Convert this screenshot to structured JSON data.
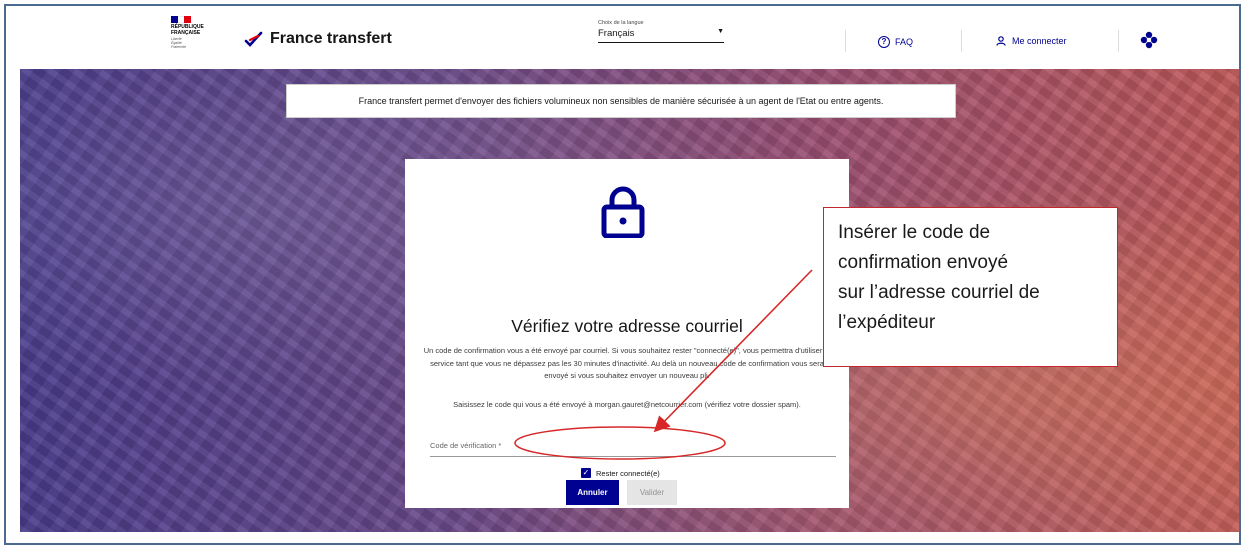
{
  "header": {
    "gov_logo_lines": [
      "RÉPUBLIQUE",
      "FRANÇAISE"
    ],
    "gov_motto": [
      "Liberté",
      "Égalité",
      "Fraternité"
    ],
    "brand_title": "France transfert",
    "language_label": "Choix de la langue",
    "language_value": "Français",
    "faq_label": "FAQ",
    "login_label": "Me connecter",
    "flag_colors": [
      "#000091",
      "#ffffff",
      "#e1000f"
    ]
  },
  "banner": {
    "text": "France transfert permet d'envoyer des fichiers volumineux non sensibles de manière sécurisée à un agent de l'Etat ou entre agents."
  },
  "card": {
    "icon": "lock-icon",
    "title": "Vérifiez votre adresse courriel",
    "paragraph1": "Un code de confirmation vous a été envoyé par courriel. Si vous souhaitez rester \"connecté(e)\", vous permettra d'utiliser le service tant que vous ne dépassez pas les 30 minutes d'inactivité. Au delà un nouveau code de confirmation vous sera envoyé si vous souhaitez envoyer un nouveau pli.",
    "paragraph2": "Saisissez le code qui vous a été envoyé à morgan.gauret@netcourrier.com (vérifiez votre dossier spam).",
    "code_label": "Code de vérification *",
    "code_value": "",
    "stay_connected_label": "Rester connecté(e)",
    "stay_connected_checked": true,
    "cancel_label": "Annuler",
    "validate_label": "Valider",
    "primary_color": "#000091"
  },
  "annotation": {
    "lines": [
      "Insérer le code de",
      "confirmation envoyé",
      "sur l’adresse courriel de",
      "l’expéditeur"
    ],
    "color": "#c1272d"
  }
}
